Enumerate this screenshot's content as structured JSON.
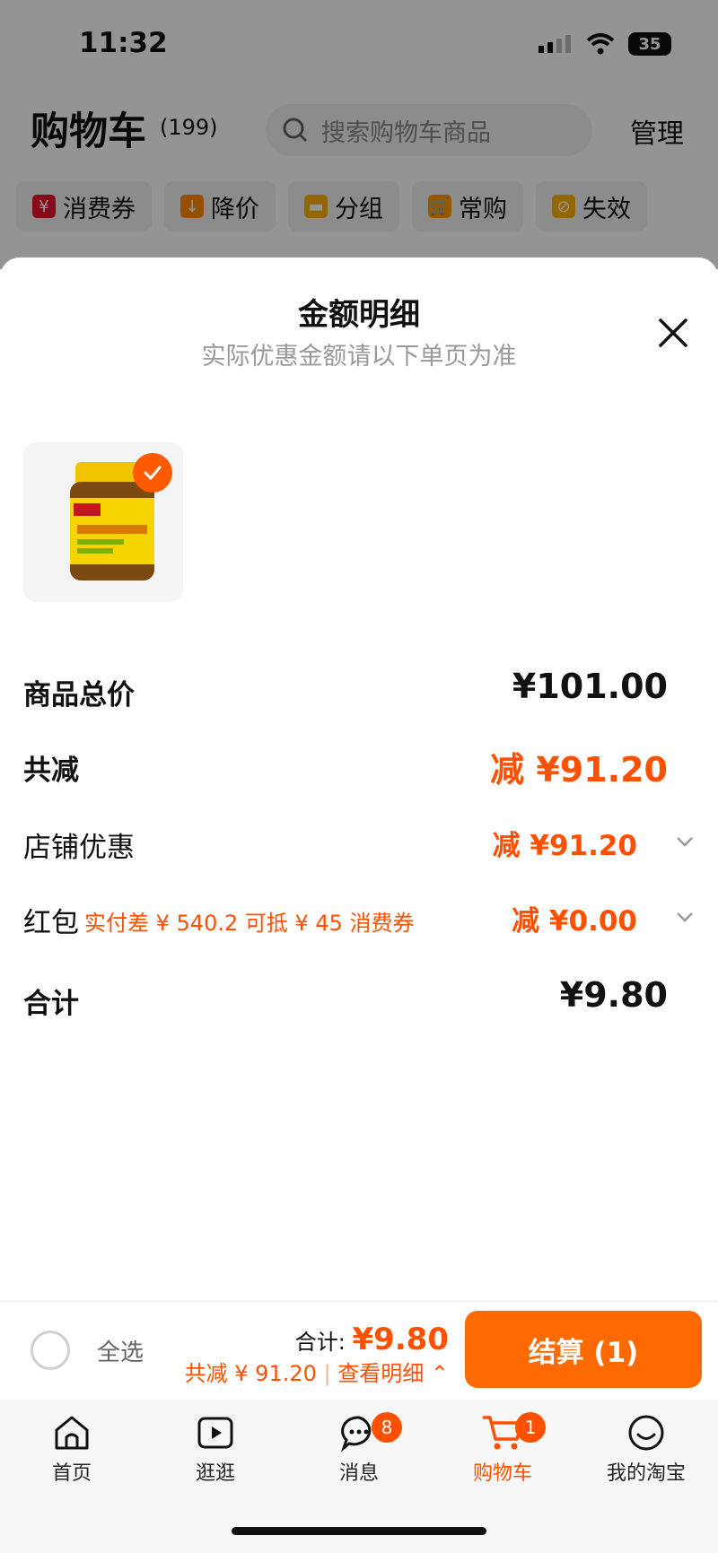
{
  "status_bar": {
    "time": "11:32",
    "battery": "35"
  },
  "header": {
    "title": "购物车",
    "count": "(199)",
    "search_placeholder": "搜索购物车商品",
    "manage": "管理",
    "chips": [
      "消费券",
      "降价",
      "分组",
      "常购",
      "失效"
    ]
  },
  "sheet": {
    "title": "金额明细",
    "subtitle": "实际优惠金额请以下单页为准",
    "product_image": "nature-made-vitamin-e-bottle",
    "rows": {
      "subtotal_label": "商品总价",
      "subtotal_amount": "¥101.00",
      "total_discount_label": "共减",
      "total_discount_amount": "减 ¥91.20",
      "shop_discount_label": "店铺优惠",
      "shop_discount_amount": "减 ¥91.20",
      "redpacket_label": "红包",
      "redpacket_note": "实付差 ¥ 540.2 可抵 ¥ 45 消费券",
      "redpacket_amount": "减 ¥0.00",
      "total_label": "合计",
      "total_amount": "¥9.80"
    }
  },
  "bottom_bar": {
    "select_all": "全选",
    "total_label": "合计:",
    "total_amount": "¥9.80",
    "discount_text": "共减 ¥ 91.20",
    "view_detail": "查看明细",
    "checkout": "结算 (1)"
  },
  "tabbar": {
    "items": [
      {
        "label": "首页"
      },
      {
        "label": "逛逛"
      },
      {
        "label": "消息",
        "badge": "8"
      },
      {
        "label": "购物车",
        "badge": "1"
      },
      {
        "label": "我的淘宝"
      }
    ]
  },
  "colors": {
    "accent": "#ff5000",
    "checkout_bg": "#ff6a00"
  }
}
